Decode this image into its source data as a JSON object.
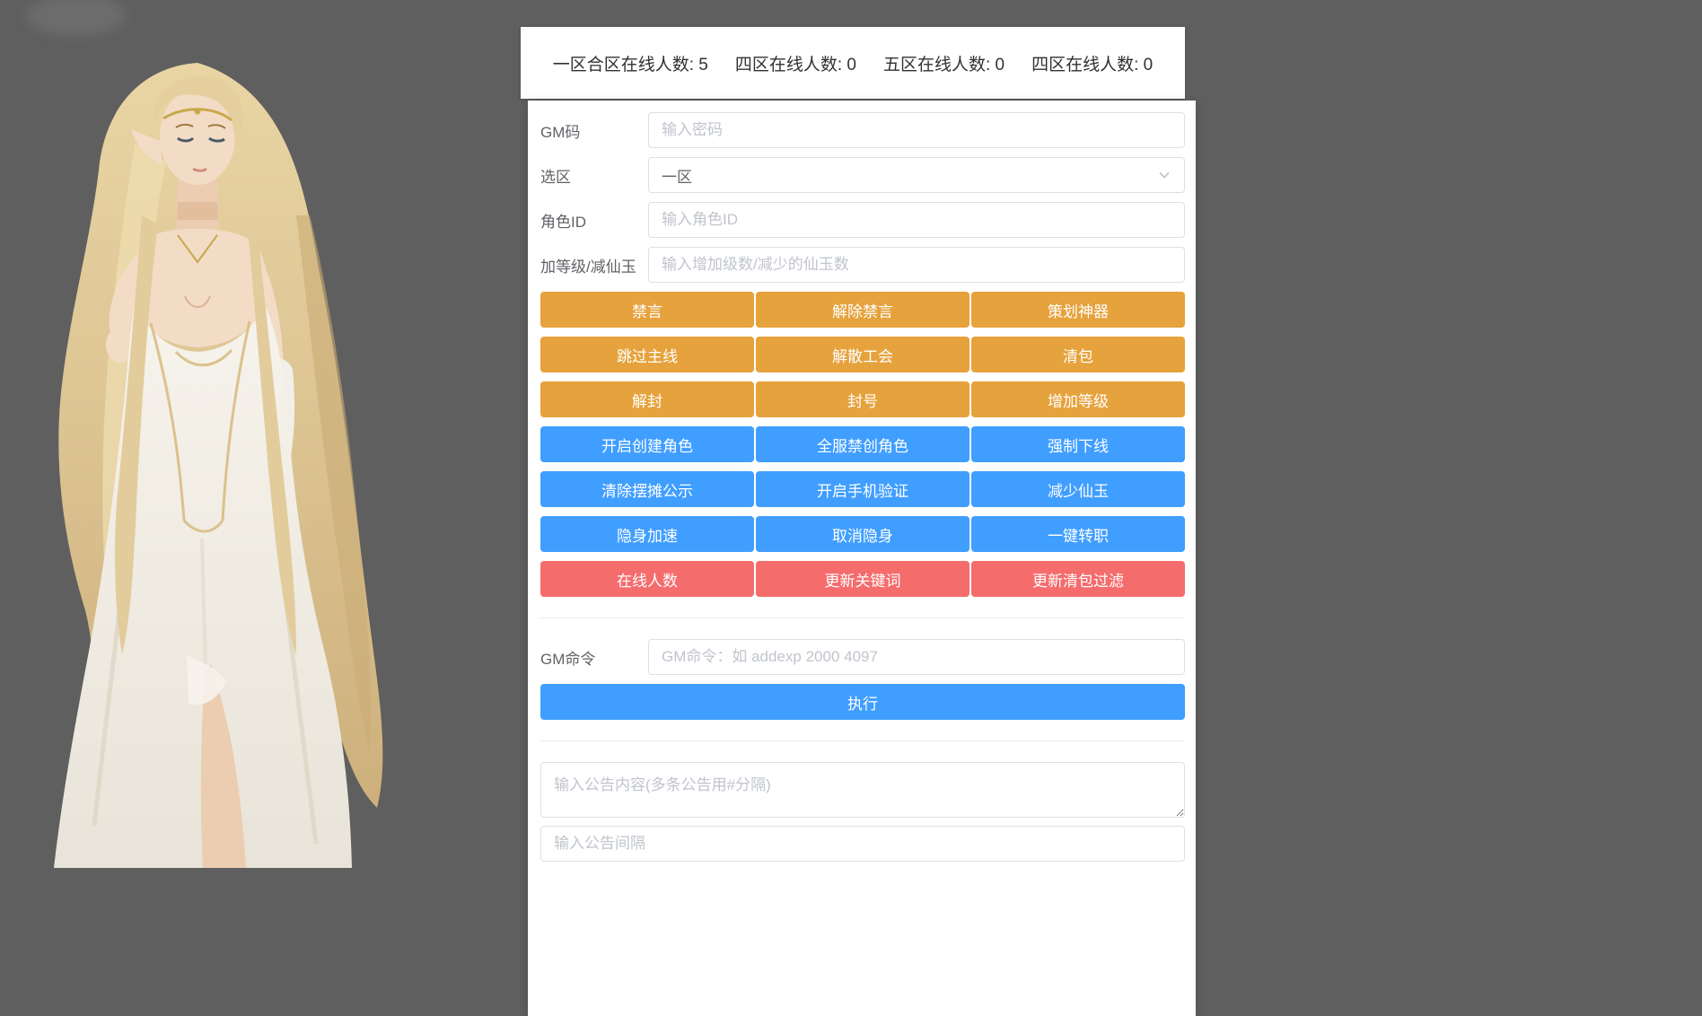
{
  "colors": {
    "background": "#5f5f5f",
    "warning": "#e6a23c",
    "primary": "#409eff",
    "danger": "#f56c6c"
  },
  "header": {
    "stats": [
      {
        "text": "一区合区在线人数: 5"
      },
      {
        "text": "四区在线人数: 0"
      },
      {
        "text": "五区在线人数: 0"
      },
      {
        "text": "四区在线人数: 0"
      }
    ]
  },
  "form": {
    "gm_code": {
      "label": "GM码",
      "placeholder": "输入密码"
    },
    "zone": {
      "label": "选区",
      "value": "一区"
    },
    "role_id": {
      "label": "角色ID",
      "placeholder": "输入角色ID"
    },
    "level_jade": {
      "label": "加等级/减仙玉",
      "placeholder": "输入增加级数/减少的仙玉数"
    }
  },
  "actions": {
    "warning": [
      [
        "禁言",
        "解除禁言",
        "策划神器"
      ],
      [
        "跳过主线",
        "解散工会",
        "清包"
      ],
      [
        "解封",
        "封号",
        "增加等级"
      ]
    ],
    "primary": [
      [
        "开启创建角色",
        "全服禁创角色",
        "强制下线"
      ],
      [
        "清除摆摊公示",
        "开启手机验证",
        "减少仙玉"
      ],
      [
        "隐身加速",
        "取消隐身",
        "一键转职"
      ]
    ],
    "danger": [
      [
        "在线人数",
        "更新关键词",
        "更新清包过滤"
      ]
    ]
  },
  "gm_command": {
    "label": "GM命令",
    "placeholder": "GM命令：如 addexp 2000 4097",
    "execute_label": "执行"
  },
  "announcement": {
    "content_placeholder": "输入公告内容(多条公告用#分隔)",
    "interval_placeholder": "输入公告间隔"
  }
}
